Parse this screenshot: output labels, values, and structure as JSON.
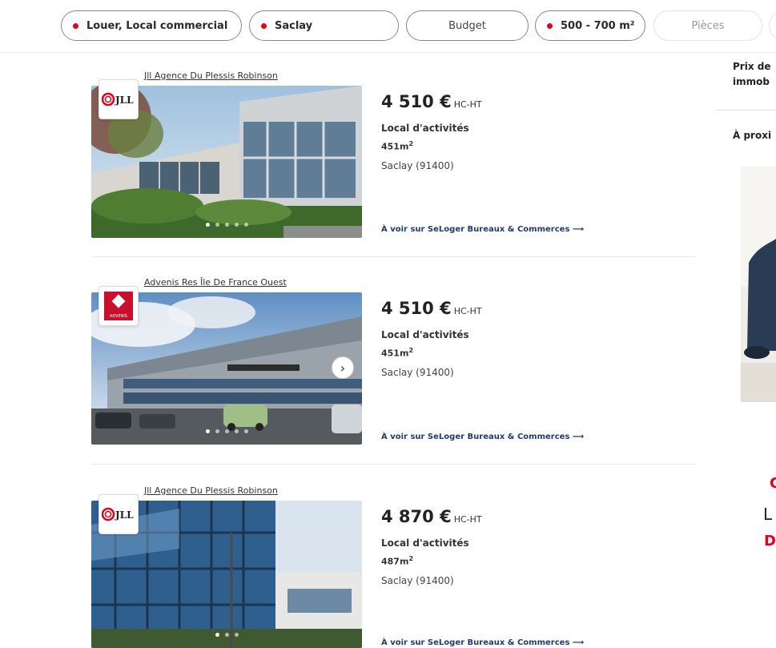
{
  "filters": [
    {
      "label": "Louer, Local commercial",
      "active": true
    },
    {
      "label": "Saclay",
      "active": true
    },
    {
      "label": "Budget",
      "active": false
    },
    {
      "label": "500 - 700 m²",
      "active": true
    },
    {
      "label": "Pièces",
      "active": false
    }
  ],
  "listings": [
    {
      "agency": "Jll Agence Du Plessis Robinson",
      "agency_logo_text": "JLL",
      "price": "4 510 €",
      "price_suffix": "HC-HT",
      "type": "Local d'activités",
      "area": "451m",
      "area_unit": "2",
      "city": "Saclay (91400)",
      "link": "À voir sur SeLoger Bureaux & Commerces ⟶",
      "photo_dots": 5,
      "active_dot": 0
    },
    {
      "agency": "Advenis Res Île De France Ouest",
      "agency_logo_text": "ADVENIS",
      "price": "4 510 €",
      "price_suffix": "HC-HT",
      "type": "Local d'activités",
      "area": "451m",
      "area_unit": "2",
      "city": "Saclay (91400)",
      "link": "À voir sur SeLoger Bureaux & Commerces ⟶",
      "photo_dots": 5,
      "active_dot": 0
    },
    {
      "agency": "Jll Agence Du Plessis Robinson",
      "agency_logo_text": "JLL",
      "price": "4 870 €",
      "price_suffix": "HC-HT",
      "type": "Local d'activités",
      "area": "487m",
      "area_unit": "2",
      "city": "Saclay (91400)",
      "link": "À voir sur SeLoger Bureaux & Commerces ⟶",
      "photo_dots": 3,
      "active_dot": 0
    }
  ],
  "sidebar": {
    "line1": "Prix de",
    "line2": "immob",
    "line3": "À proxi",
    "promo_red_1": "C",
    "promo_dark": "L",
    "promo_red_2": "D"
  },
  "colors": {
    "accent_red": "#e2001a",
    "link_blue": "#1f3c6e"
  },
  "icons": {
    "next": "chevron-right-icon"
  }
}
